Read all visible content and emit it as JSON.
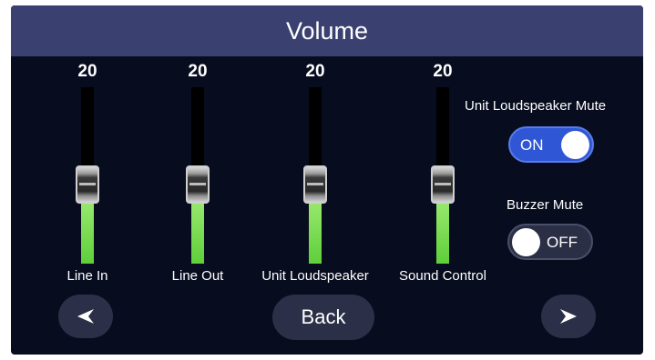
{
  "title": "Volume",
  "sliders": [
    {
      "label": "Line In",
      "value": "20",
      "level": 0.45
    },
    {
      "label": "Line Out",
      "value": "20",
      "level": 0.45
    },
    {
      "label": "Unit Loudspeaker",
      "value": "20",
      "level": 0.45
    },
    {
      "label": "Sound Control",
      "value": "20",
      "level": 0.45
    }
  ],
  "unit_mute": {
    "label": "Unit Loudspeaker Mute",
    "state": "ON"
  },
  "buzzer_mute": {
    "label": "Buzzer Mute",
    "state": "OFF"
  },
  "nav": {
    "back_label": "Back",
    "prev_icon": "left-arrow-icon",
    "next_icon": "right-arrow-icon"
  },
  "colors": {
    "background": "#070c1e",
    "titlebar": "#3a4170",
    "fill": "#7de05a",
    "toggle_on": "#2f56d4",
    "button": "#2b3048"
  }
}
